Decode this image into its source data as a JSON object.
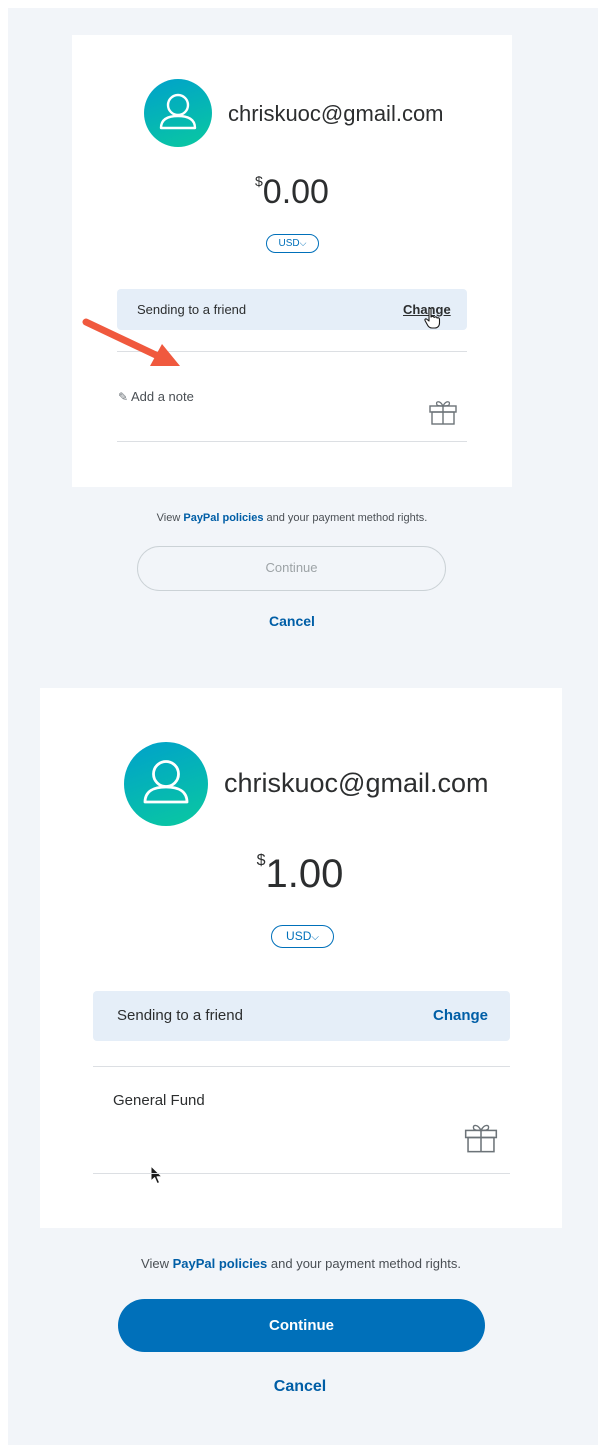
{
  "first_screen": {
    "recipient_email": "chriskuoc@gmail.com",
    "currency_symbol": "$",
    "amount": "0.00",
    "currency_code": "USD",
    "chevron": "⌵",
    "sending_label": "Sending to a friend",
    "change_label": "Change",
    "note_icon": "✎",
    "note_placeholder": "Add a note",
    "policy_prefix": "View ",
    "policy_link": "PayPal policies",
    "policy_suffix": " and your payment method rights.",
    "continue_label": "Continue",
    "cancel_label": "Cancel"
  },
  "second_screen": {
    "recipient_email": "chriskuoc@gmail.com",
    "currency_symbol": "$",
    "amount": "1.00",
    "currency_code": "USD",
    "chevron": "⌵",
    "sending_label": "Sending to a friend",
    "change_label": "Change",
    "note_value": "General Fund",
    "policy_prefix": "View ",
    "policy_link": "PayPal policies",
    "policy_suffix": " and your payment method rights.",
    "continue_label": "Continue",
    "cancel_label": "Cancel"
  },
  "colors": {
    "background": "#f2f5f9",
    "accent_blue": "#0070ba",
    "link_blue": "#005ea6",
    "friend_bar": "#e5eef8",
    "arrow": "#f0593e",
    "avatar_start": "#00a1cb",
    "avatar_end": "#0ac9a0"
  },
  "icons": {
    "avatar": "user-avatar-icon",
    "gift": "gift-icon",
    "note": "pencil-icon",
    "arrow": "annotation-arrow",
    "hand_cursor": "hand-pointer-cursor",
    "arrow_cursor": "arrow-pointer-cursor"
  }
}
